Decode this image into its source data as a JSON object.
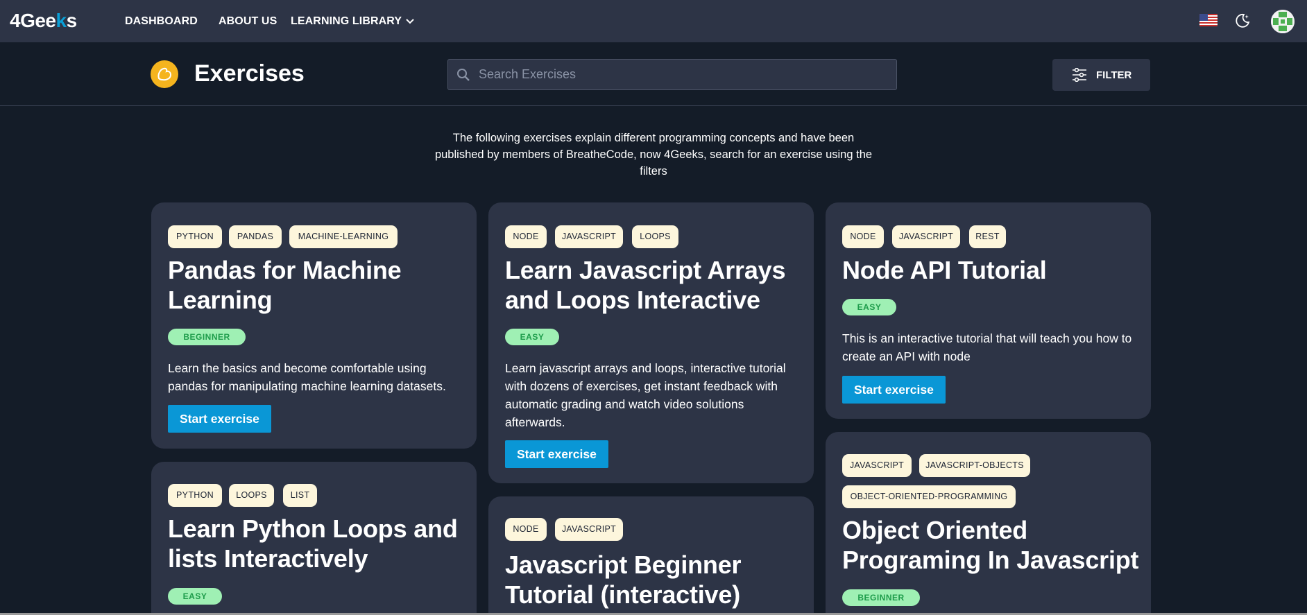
{
  "nav": {
    "logo_main": "4Gee",
    "logo_k": "k",
    "logo_end": "s",
    "items": [
      "DASHBOARD",
      "ABOUT US",
      "LEARNING LIBRARY"
    ]
  },
  "header": {
    "title": "Exercises",
    "search_placeholder": "Search Exercises",
    "filter_label": "FILTER"
  },
  "intro": "The following exercises explain different programming concepts and have been published by members of BreatheCode, now 4Geeks, search for an exercise using the filters",
  "cards": [
    {
      "tags": [
        "PYTHON",
        "PANDAS",
        "MACHINE-LEARNING"
      ],
      "title_lines": [
        "Pandas for Machine",
        "Learning"
      ],
      "level": "BEGINNER",
      "description": "Learn the basics and become comfortable using pandas for manipulating machine learning datasets.",
      "button": "Start exercise"
    },
    {
      "tags": [
        "NODE",
        "JAVASCRIPT",
        "LOOPS"
      ],
      "title_lines": [
        "Learn Javascript Arrays",
        "and Loops Interactive"
      ],
      "level": "EASY",
      "description": "Learn javascript arrays and loops, interactive tutorial with dozens of exercises, get instant feedback with automatic grading and watch video solutions afterwards.",
      "button": "Start exercise"
    },
    {
      "tags": [
        "NODE",
        "JAVASCRIPT",
        "REST"
      ],
      "title_lines": [
        "Node API Tutorial"
      ],
      "level": "EASY",
      "description": "This is an interactive tutorial that will teach you how to create an API with node",
      "button": "Start exercise"
    },
    {
      "tags": [
        "PYTHON",
        "LOOPS",
        "LIST"
      ],
      "title_lines": [
        "Learn Python Loops and",
        "lists Interactively"
      ],
      "level": "EASY"
    },
    {
      "tags": [
        "NODE",
        "JAVASCRIPT"
      ],
      "title_lines": [
        "Javascript Beginner",
        "Tutorial (interactive)"
      ]
    },
    {
      "tags": [
        "JAVASCRIPT",
        "JAVASCRIPT-OBJECTS",
        "OBJECT-ORIENTED-PROGRAMMING"
      ],
      "title_lines": [
        "Object Oriented",
        "Programing In Javascript"
      ],
      "level": "BEGINNER"
    }
  ],
  "colors": {
    "bg": "#141c28",
    "card": "#2d3446",
    "accent": "#0a97d6",
    "tag_bg": "#fdf6dc",
    "level_bg": "#9ff0b4",
    "level_text": "#1e9c4b",
    "exercise_icon": "#f5b41e"
  },
  "icons": [
    "us-flag-icon",
    "dark-mode-icon",
    "avatar",
    "exercise-icon",
    "search-icon",
    "filter-icon",
    "chevron-down-icon"
  ]
}
